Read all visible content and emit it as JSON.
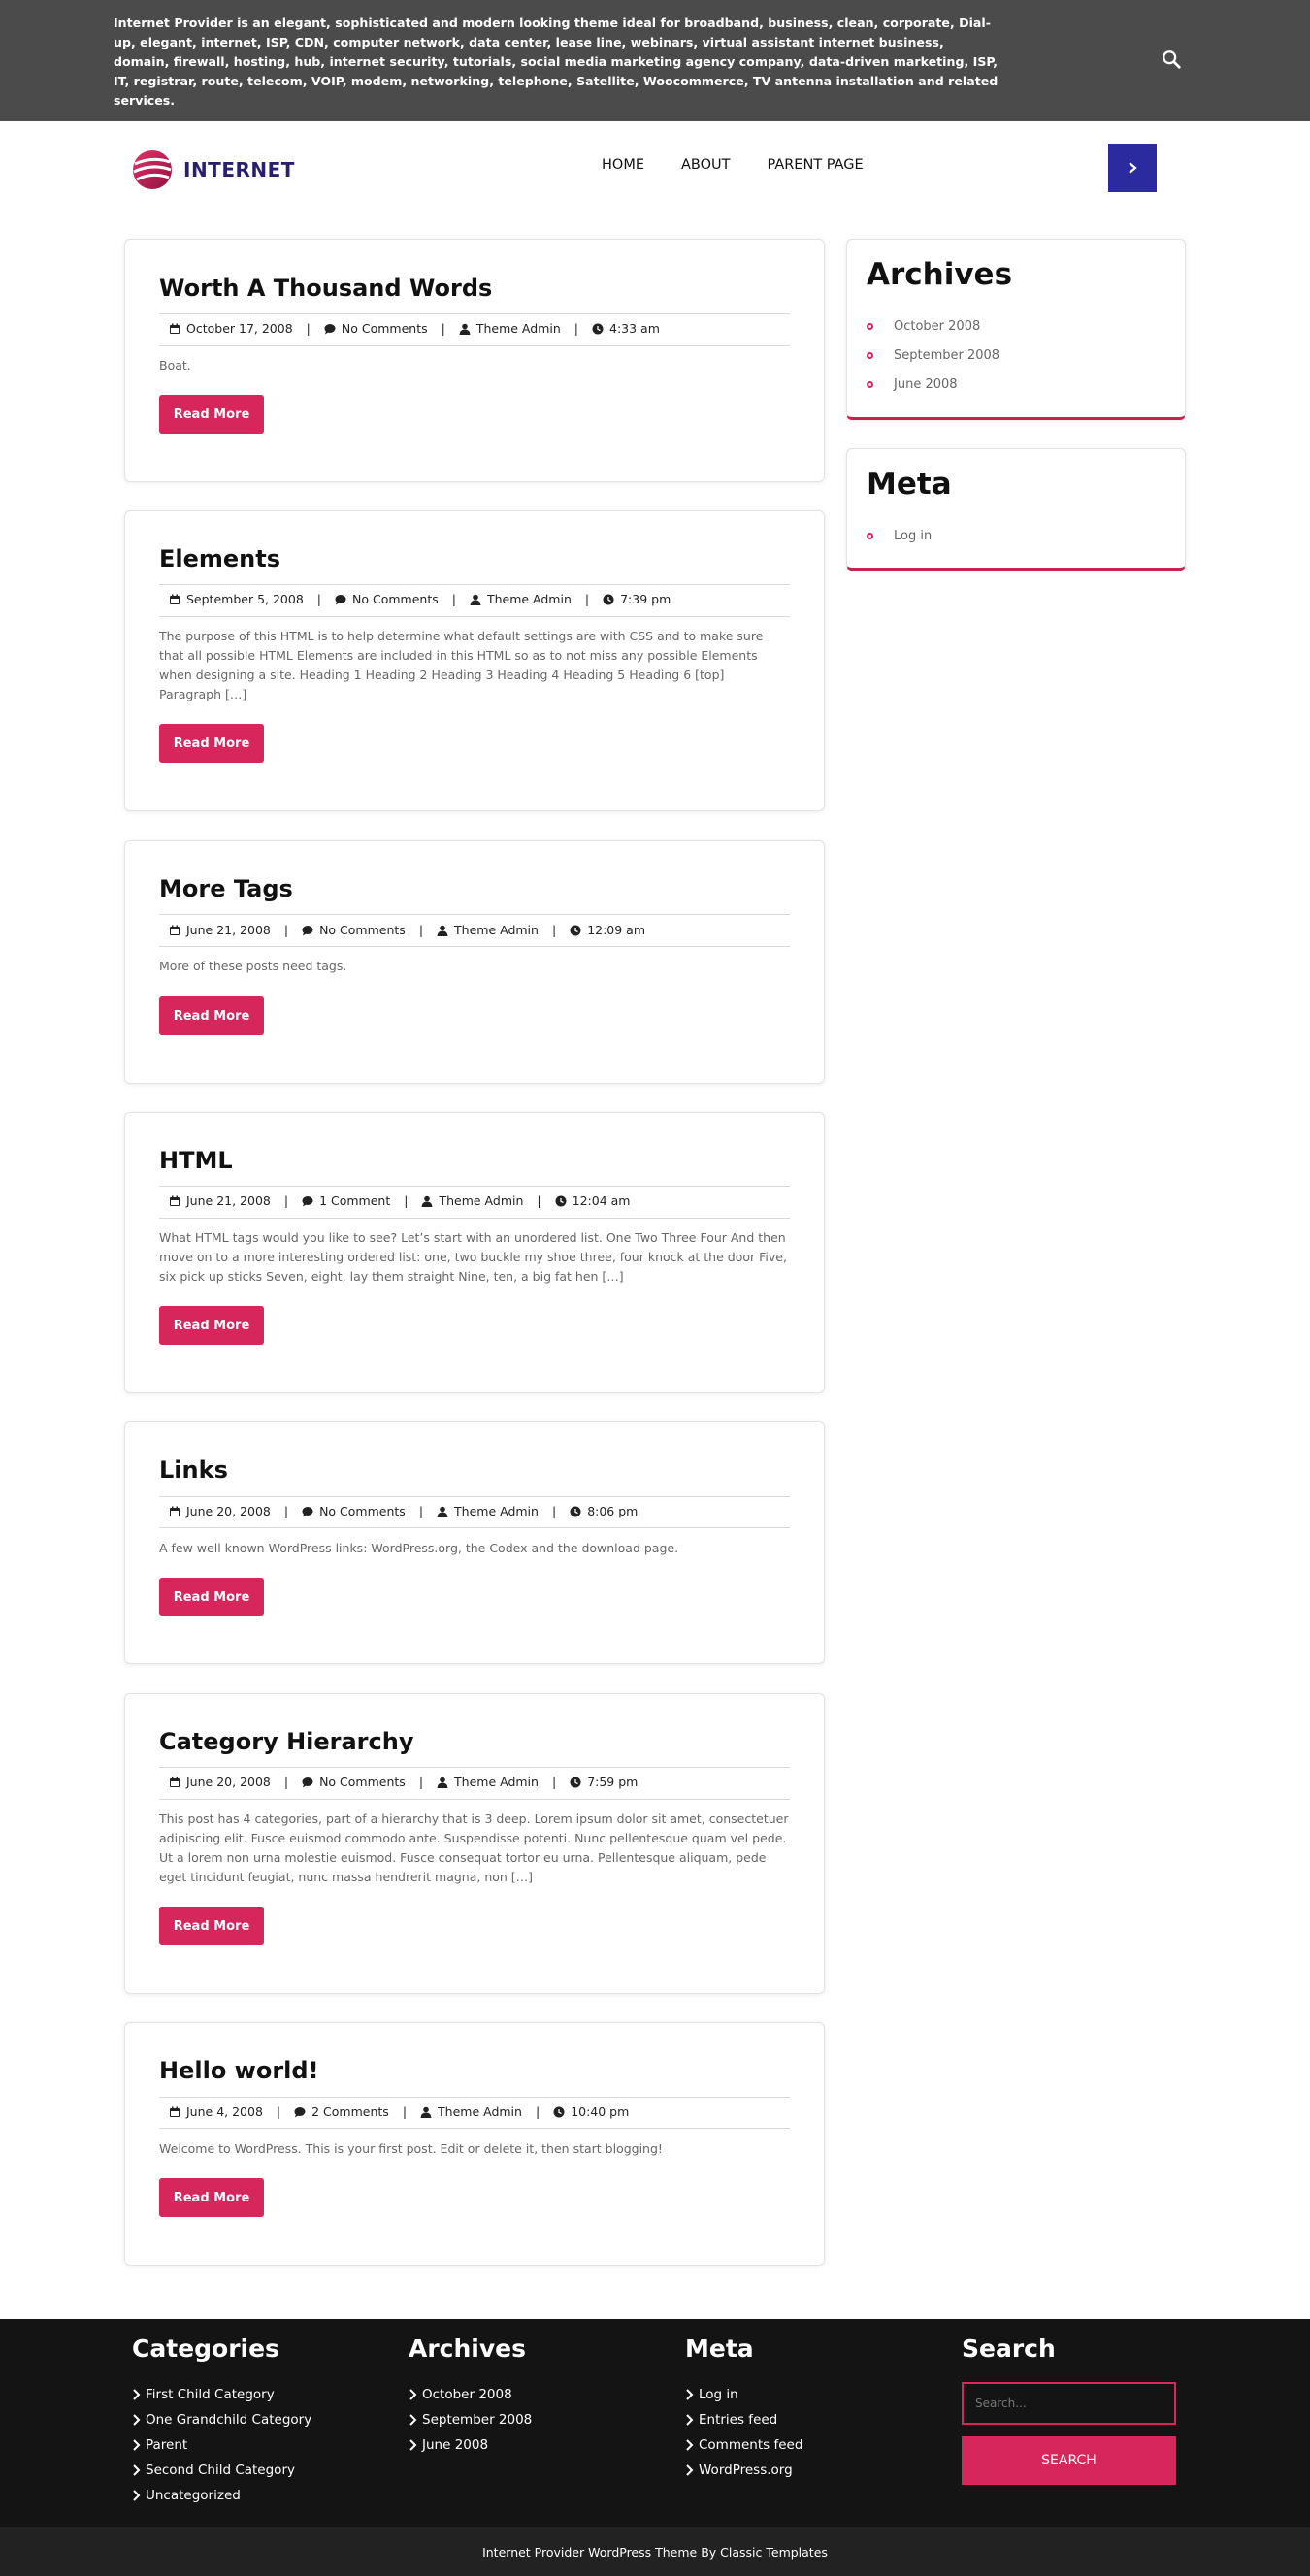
{
  "topbar": {
    "text": "Internet Provider is an elegant, sophisticated and modern looking theme ideal for broadband, business, clean, corporate, Dial-up, elegant, internet, ISP, CDN, computer network, data center, lease line, webinars, virtual assistant internet business, domain, firewall, hosting, hub, internet security, tutorials, social media marketing agency company, data-driven marketing, ISP, IT, registrar, route, telecom, VOIP, modem, networking, telephone, Satellite, Woocommerce, TV antenna installation and related services.",
    "search_icon": "search-icon"
  },
  "header": {
    "logo_text": "INTERNET",
    "nav": [
      "HOME",
      "ABOUT",
      "PARENT PAGE"
    ],
    "menu_button_icon": "chevron-right-icon"
  },
  "posts": [
    {
      "title": "Worth A Thousand Words",
      "date": "October 17, 2008",
      "comments": "No Comments",
      "author": "Theme Admin",
      "time": "4:33 am",
      "excerpt": "Boat.",
      "read_more": "Read More"
    },
    {
      "title": "Elements",
      "date": "September 5, 2008",
      "comments": "No Comments",
      "author": "Theme Admin",
      "time": "7:39 pm",
      "excerpt": "The purpose of this HTML is to help determine what default settings are with CSS and to make sure that all possible HTML Elements are included in this HTML so as to not miss any possible Elements when designing a site. Heading 1 Heading 2 Heading 3 Heading 4 Heading 5 Heading 6 [top] Paragraph […]",
      "read_more": "Read More"
    },
    {
      "title": "More Tags",
      "date": "June 21, 2008",
      "comments": "No Comments",
      "author": "Theme Admin",
      "time": "12:09 am",
      "excerpt": "More of these posts need tags.",
      "read_more": "Read More"
    },
    {
      "title": "HTML",
      "date": "June 21, 2008",
      "comments": "1 Comment",
      "author": "Theme Admin",
      "time": "12:04 am",
      "excerpt": "What HTML tags would you like to see? Let’s start with an unordered list. One Two Three Four And then move on to a more interesting ordered list: one, two buckle my shoe three, four knock at the door Five, six pick up sticks Seven, eight, lay them straight Nine, ten, a big fat hen […]",
      "read_more": "Read More"
    },
    {
      "title": "Links",
      "date": "June 20, 2008",
      "comments": "No Comments",
      "author": "Theme Admin",
      "time": "8:06 pm",
      "excerpt": "A few well known WordPress links: WordPress.org, the Codex and the download page.",
      "read_more": "Read More"
    },
    {
      "title": "Category Hierarchy",
      "date": "June 20, 2008",
      "comments": "No Comments",
      "author": "Theme Admin",
      "time": "7:59 pm",
      "excerpt": "This post has 4 categories, part of a hierarchy that is 3 deep. Lorem ipsum dolor sit amet, consectetuer adipiscing elit. Fusce euismod commodo ante. Suspendisse potenti. Nunc pellentesque quam vel pede. Ut a lorem non urna molestie euismod. Fusce consequat tortor eu urna. Pellentesque aliquam, pede eget tincidunt feugiat, nunc massa hendrerit magna, non […]",
      "read_more": "Read More"
    },
    {
      "title": "Hello world!",
      "date": "June 4, 2008",
      "comments": "2 Comments",
      "author": "Theme Admin",
      "time": "10:40 pm",
      "excerpt": "Welcome to WordPress. This is your first post. Edit or delete it, then start blogging!",
      "read_more": "Read More"
    }
  ],
  "sidebar": {
    "archives": {
      "title": "Archives",
      "items": [
        "October 2008",
        "September 2008",
        "June 2008"
      ]
    },
    "meta": {
      "title": "Meta",
      "items": [
        "Log in"
      ]
    }
  },
  "footer": {
    "categories": {
      "title": "Categories",
      "items": [
        "First Child Category",
        "One Grandchild Category",
        "Parent",
        "Second Child Category",
        "Uncategorized"
      ]
    },
    "archives": {
      "title": "Archives",
      "items": [
        "October 2008",
        "September 2008",
        "June 2008"
      ]
    },
    "meta": {
      "title": "Meta",
      "items": [
        "Log in",
        "Entries feed",
        "Comments feed",
        "WordPress.org"
      ]
    },
    "search": {
      "title": "Search",
      "placeholder": "Search...",
      "button": "SEARCH"
    }
  },
  "bottombar": {
    "text": "Internet Provider WordPress Theme By Classic Templates"
  },
  "colors": {
    "accent": "#d6265b",
    "nav_button": "#2b2a9f",
    "topbar": "#4b4b4b",
    "footer": "#141414",
    "logo_text": "#2a1f6e"
  }
}
